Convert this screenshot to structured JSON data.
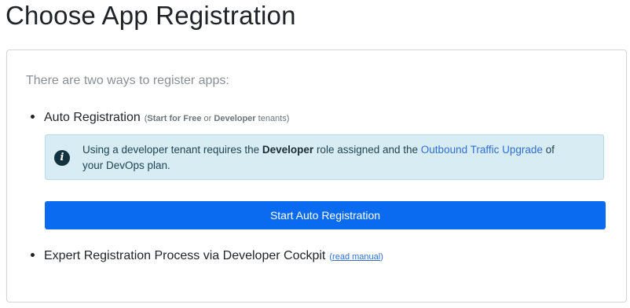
{
  "page": {
    "title": "Choose App Registration"
  },
  "card": {
    "intro": "There are two ways to register apps:",
    "auto_option": {
      "label": "Auto Registration",
      "hint_open": "(",
      "hint_start": "Start for Free",
      "hint_or": " or ",
      "hint_dev": "Developer",
      "hint_end": " tenants)"
    },
    "info": {
      "icon": "info-circle-icon",
      "text_1": "Using a developer tenant requires the ",
      "text_bold": "Developer",
      "text_2": " role assigned and the ",
      "link": "Outbound Traffic Upgrade",
      "text_3": " of your DevOps plan."
    },
    "auto_button": "Start Auto Registration",
    "expert_option": {
      "label": "Expert Registration Process via Developer Cockpit",
      "link_open": "(",
      "link": "read manual",
      "link_close": ")"
    }
  },
  "colors": {
    "primary": "#0b6bf0",
    "info_bg": "#d8ecf3",
    "link": "#2f6fd6"
  }
}
